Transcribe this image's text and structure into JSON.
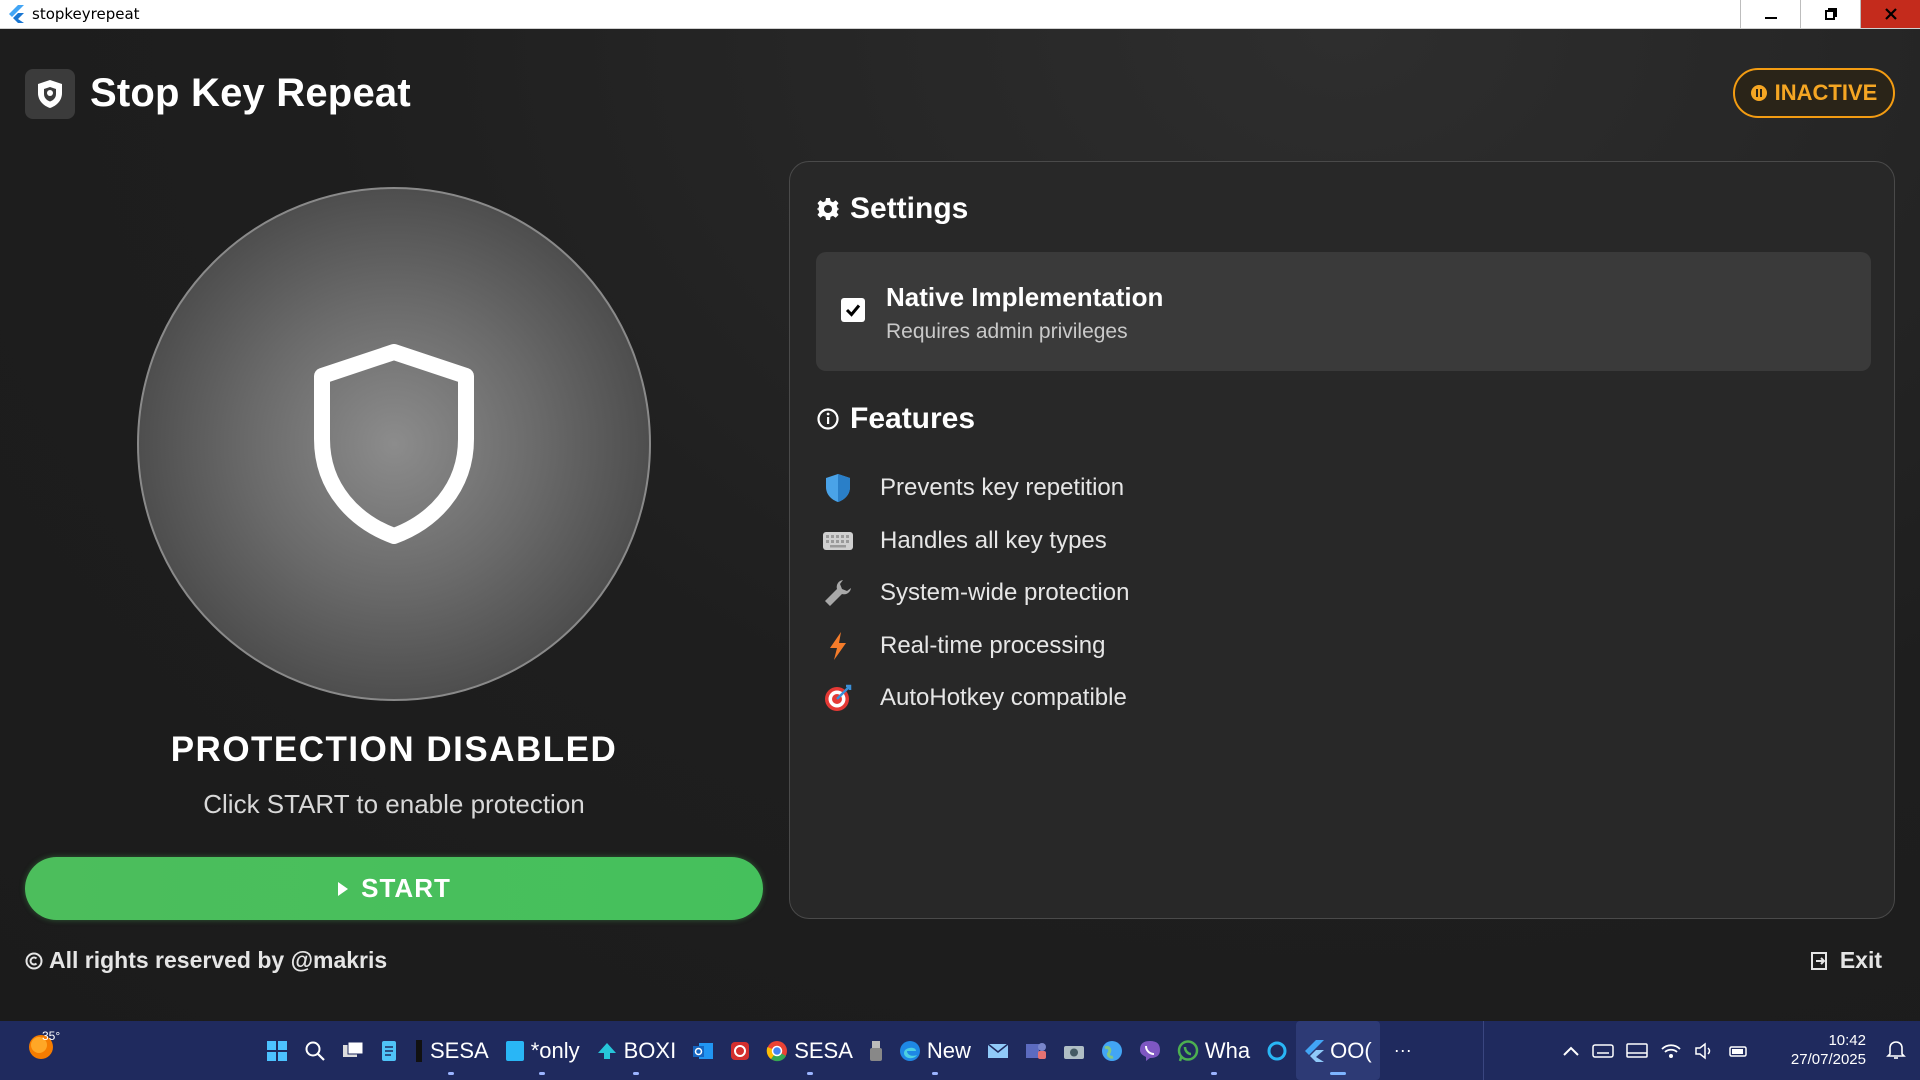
{
  "window": {
    "title": "stopkeyrepeat",
    "controls": [
      "minimize-icon",
      "restore-icon",
      "close-icon"
    ]
  },
  "header": {
    "title": "Stop Key Repeat",
    "status": "INACTIVE",
    "status_color": "#f39c12"
  },
  "protection": {
    "title": "PROTECTION DISABLED",
    "subtitle": "Click START to enable protection"
  },
  "start_button": {
    "label": "START",
    "color": "#4cbe5c"
  },
  "footer": {
    "copyright": "All rights reserved by @makris",
    "exit_label": "Exit"
  },
  "settings": {
    "title": "Settings",
    "native": {
      "title": "Native Implementation",
      "subtitle": "Requires admin privileges",
      "checked": true
    }
  },
  "features": {
    "title": "Features",
    "items": [
      {
        "label": "Prevents key repetition",
        "icon": "shield-icon"
      },
      {
        "label": "Handles all key types",
        "icon": "keyboard-icon"
      },
      {
        "label": "System-wide protection",
        "icon": "wrench-icon"
      },
      {
        "label": "Real-time processing",
        "icon": "lightning-icon"
      },
      {
        "label": "AutoHotkey compatible",
        "icon": "target-icon"
      }
    ]
  },
  "taskbar": {
    "weather_temp": "35°",
    "items": [
      {
        "label": "",
        "icon": "windows-start-icon"
      },
      {
        "label": "",
        "icon": "search-icon"
      },
      {
        "label": "",
        "icon": "task-view-icon"
      },
      {
        "label": "",
        "icon": "notepad-icon"
      },
      {
        "label": "SESA",
        "icon": "terminal-icon"
      },
      {
        "label": "*only",
        "icon": "notepad-icon"
      },
      {
        "label": "BOXI",
        "icon": "upload-icon"
      },
      {
        "label": "",
        "icon": "outlook-icon"
      },
      {
        "label": "",
        "icon": "app-icon"
      },
      {
        "label": "SESA",
        "icon": "chrome-icon"
      },
      {
        "label": "",
        "icon": "usb-icon"
      },
      {
        "label": "New",
        "icon": "edge-icon"
      },
      {
        "label": "",
        "icon": "mail-icon"
      },
      {
        "label": "",
        "icon": "teams-icon"
      },
      {
        "label": "",
        "icon": "camera-icon"
      },
      {
        "label": "",
        "icon": "globe-icon"
      },
      {
        "label": "",
        "icon": "viber-icon"
      },
      {
        "label": "Wha",
        "icon": "whatsapp-icon"
      },
      {
        "label": "",
        "icon": "cortana-icon"
      },
      {
        "label": "OO(",
        "icon": "flutter-icon"
      },
      {
        "label": "···",
        "icon": "more-icon"
      }
    ],
    "clock_time": "10:42",
    "clock_date": "27/07/2025"
  }
}
